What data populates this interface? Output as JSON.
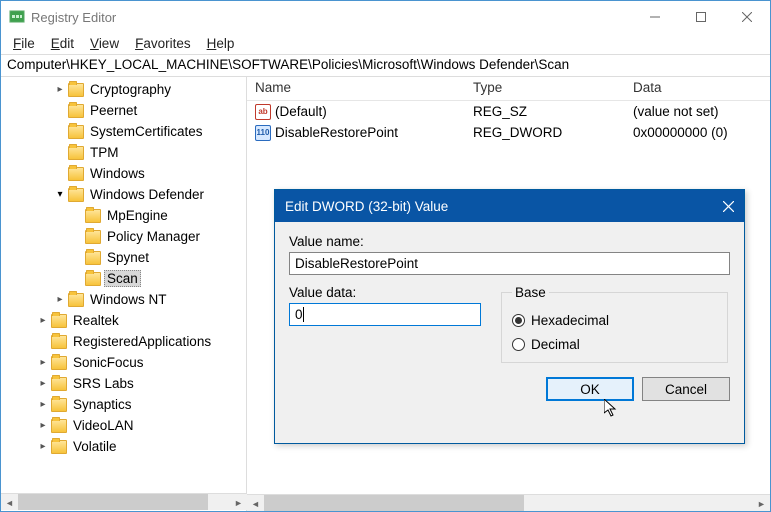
{
  "title": "Registry Editor",
  "window_controls": {
    "min": "minimize-icon",
    "max": "maximize-icon",
    "close": "close-icon"
  },
  "menus": [
    "File",
    "Edit",
    "View",
    "Favorites",
    "Help"
  ],
  "address": "Computer\\HKEY_LOCAL_MACHINE\\SOFTWARE\\Policies\\Microsoft\\Windows Defender\\Scan",
  "tree": [
    {
      "indent": 3,
      "twisty": "collapsed",
      "label": "Cryptography"
    },
    {
      "indent": 3,
      "twisty": "none",
      "label": "Peernet"
    },
    {
      "indent": 3,
      "twisty": "none",
      "label": "SystemCertificates"
    },
    {
      "indent": 3,
      "twisty": "none",
      "label": "TPM"
    },
    {
      "indent": 3,
      "twisty": "none",
      "label": "Windows"
    },
    {
      "indent": 3,
      "twisty": "expanded",
      "label": "Windows Defender"
    },
    {
      "indent": 4,
      "twisty": "none",
      "label": "MpEngine"
    },
    {
      "indent": 4,
      "twisty": "none",
      "label": "Policy Manager"
    },
    {
      "indent": 4,
      "twisty": "none",
      "label": "Spynet"
    },
    {
      "indent": 4,
      "twisty": "none",
      "label": "Scan",
      "selected": true
    },
    {
      "indent": 3,
      "twisty": "collapsed",
      "label": "Windows NT"
    },
    {
      "indent": 2,
      "twisty": "collapsed",
      "label": "Realtek"
    },
    {
      "indent": 2,
      "twisty": "none",
      "label": "RegisteredApplications"
    },
    {
      "indent": 2,
      "twisty": "collapsed",
      "label": "SonicFocus"
    },
    {
      "indent": 2,
      "twisty": "collapsed",
      "label": "SRS Labs"
    },
    {
      "indent": 2,
      "twisty": "collapsed",
      "label": "Synaptics"
    },
    {
      "indent": 2,
      "twisty": "collapsed",
      "label": "VideoLAN"
    },
    {
      "indent": 2,
      "twisty": "collapsed",
      "label": "Volatile"
    }
  ],
  "columns": {
    "name": "Name",
    "type": "Type",
    "data": "Data"
  },
  "values": [
    {
      "icon": "str",
      "name": "(Default)",
      "type": "REG_SZ",
      "data": "(value not set)"
    },
    {
      "icon": "dw",
      "name": "DisableRestorePoint",
      "type": "REG_DWORD",
      "data": "0x00000000 (0)"
    }
  ],
  "dialog": {
    "title": "Edit DWORD (32-bit) Value",
    "name_label": "Value name:",
    "name_value": "DisableRestorePoint",
    "data_label": "Value data:",
    "data_value": "0",
    "base_label": "Base",
    "radio_hex": "Hexadecimal",
    "radio_dec": "Decimal",
    "base_selected": "hex",
    "ok": "OK",
    "cancel": "Cancel"
  }
}
